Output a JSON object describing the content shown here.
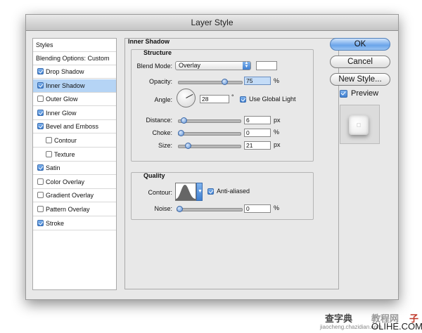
{
  "window": {
    "title": "Layer Style"
  },
  "styles_list": {
    "header": "Styles",
    "blending": "Blending Options: Custom",
    "items": [
      {
        "label": "Drop Shadow",
        "checked": true,
        "selected": false,
        "indent": false
      },
      {
        "label": "Inner Shadow",
        "checked": true,
        "selected": true,
        "indent": false
      },
      {
        "label": "Outer Glow",
        "checked": false,
        "selected": false,
        "indent": false
      },
      {
        "label": "Inner Glow",
        "checked": true,
        "selected": false,
        "indent": false
      },
      {
        "label": "Bevel and Emboss",
        "checked": true,
        "selected": false,
        "indent": false
      },
      {
        "label": "Contour",
        "checked": false,
        "selected": false,
        "indent": true
      },
      {
        "label": "Texture",
        "checked": false,
        "selected": false,
        "indent": true
      },
      {
        "label": "Satin",
        "checked": true,
        "selected": false,
        "indent": false
      },
      {
        "label": "Color Overlay",
        "checked": false,
        "selected": false,
        "indent": false
      },
      {
        "label": "Gradient Overlay",
        "checked": false,
        "selected": false,
        "indent": false
      },
      {
        "label": "Pattern Overlay",
        "checked": false,
        "selected": false,
        "indent": false
      },
      {
        "label": "Stroke",
        "checked": true,
        "selected": false,
        "indent": false
      }
    ]
  },
  "inner_shadow": {
    "title": "Inner Shadow",
    "structure": {
      "title": "Structure",
      "blend_mode_label": "Blend Mode:",
      "blend_mode_value": "Overlay",
      "blend_color": "#ffffff",
      "opacity_label": "Opacity:",
      "opacity_value": "75",
      "opacity_unit": "%",
      "opacity_level": 0.75,
      "angle_label": "Angle:",
      "angle_value": "28",
      "angle_unit": "°",
      "global_light_label": "Use Global Light",
      "global_light_checked": true,
      "distance_label": "Distance:",
      "distance_value": "6",
      "distance_unit": "px",
      "distance_level": 0.05,
      "choke_label": "Choke:",
      "choke_value": "0",
      "choke_unit": "%",
      "choke_level": 0.0,
      "size_label": "Size:",
      "size_value": "21",
      "size_unit": "px",
      "size_level": 0.12
    },
    "quality": {
      "title": "Quality",
      "contour_label": "Contour:",
      "anti_aliased_label": "Anti-aliased",
      "anti_aliased_checked": true,
      "noise_label": "Noise:",
      "noise_value": "0",
      "noise_unit": "%",
      "noise_level": 0.0
    }
  },
  "buttons": {
    "ok": "OK",
    "cancel": "Cancel",
    "new_style": "New Style...",
    "preview_label": "Preview",
    "preview_checked": true
  },
  "watermark": {
    "left": "查字典",
    "mid": "教程网",
    "right": "子",
    "url": "jiaocheng.chazidian.com",
    "logo": "OLIHE.COM"
  },
  "colors": {
    "accent": "#3f7fd0",
    "selection": "#b5d4f5"
  }
}
